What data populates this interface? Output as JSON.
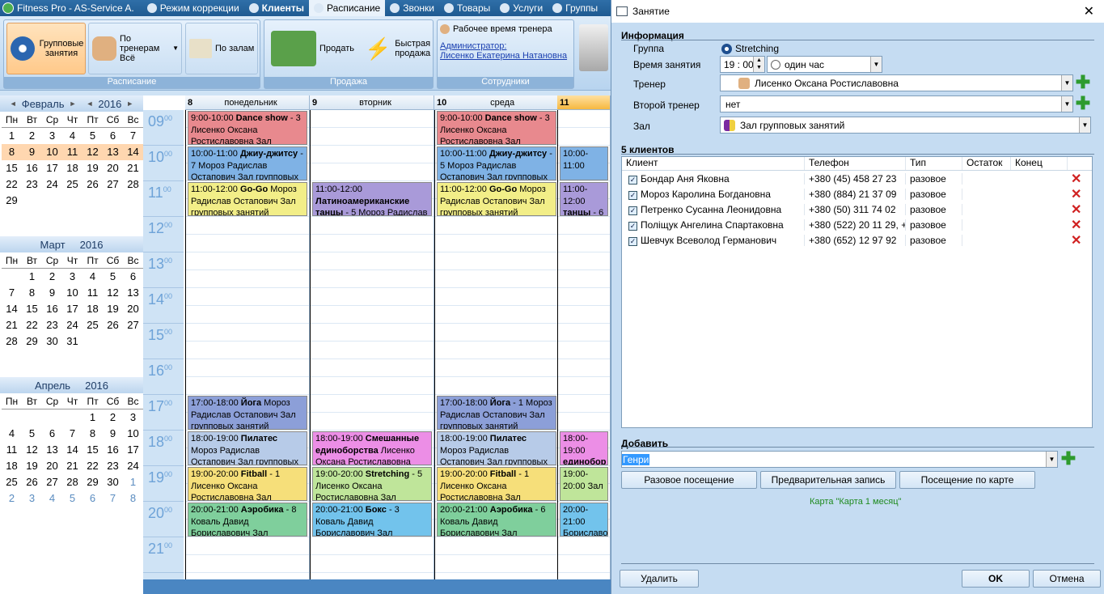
{
  "titlebar": {
    "app": "Fitness Pro - AS-Service A.",
    "tabs": [
      {
        "label": "Режим коррекции",
        "icon": "gear-icon"
      },
      {
        "label": "Клиенты",
        "icon": "people-icon",
        "bold": true
      },
      {
        "label": "Расписание",
        "icon": "calendar-icon",
        "active": true
      },
      {
        "label": "Звонки",
        "icon": "phone-icon"
      },
      {
        "label": "Товары",
        "icon": "box-icon"
      },
      {
        "label": "Услуги",
        "icon": "service-icon"
      },
      {
        "label": "Группы",
        "icon": "group-icon"
      }
    ]
  },
  "ribbon": {
    "groups": [
      {
        "title": "Расписание"
      },
      {
        "title": "Продажа"
      },
      {
        "title": "Сотрудники"
      }
    ],
    "group_classes_label": "Групповые занятия",
    "by_trainers_label": "По тренерам",
    "by_trainers_value": "Всё",
    "by_halls_label": "По залам",
    "sell_label": "Продать",
    "quick_sale_label": "Быстрая продажа",
    "trainer_time_label": "Рабочее время тренера",
    "admin_label": "Администратор:",
    "admin_name": "Лисенко Екатерина Натановна"
  },
  "calendar": {
    "weekdays": [
      "Пн",
      "Вт",
      "Ср",
      "Чт",
      "Пт",
      "Сб",
      "Вс"
    ],
    "months": [
      {
        "name": "Февраль",
        "year": "2016",
        "nav": true,
        "lead": 0,
        "days": [
          "1",
          "2",
          "3",
          "4",
          "5",
          "6",
          "7",
          "8",
          "9",
          "10",
          "11",
          "12",
          "13",
          "14",
          "15",
          "16",
          "17",
          "18",
          "19",
          "20",
          "21",
          "22",
          "23",
          "24",
          "25",
          "26",
          "27",
          "28",
          "29"
        ],
        "highlight": [
          "8",
          "9",
          "10",
          "11",
          "12",
          "13",
          "14"
        ],
        "trail": []
      },
      {
        "name": "Март",
        "year": "2016",
        "nav": false,
        "lead": 1,
        "days": [
          "1",
          "2",
          "3",
          "4",
          "5",
          "6",
          "7",
          "8",
          "9",
          "10",
          "11",
          "12",
          "13",
          "14",
          "15",
          "16",
          "17",
          "18",
          "19",
          "20",
          "21",
          "22",
          "23",
          "24",
          "25",
          "26",
          "27",
          "28",
          "29",
          "30",
          "31"
        ],
        "highlight": [],
        "trail": []
      },
      {
        "name": "Апрель",
        "year": "2016",
        "nav": false,
        "lead": 4,
        "days": [
          "1",
          "2",
          "3",
          "4",
          "5",
          "6",
          "7",
          "8",
          "9",
          "10",
          "11",
          "12",
          "13",
          "14",
          "15",
          "16",
          "17",
          "18",
          "19",
          "20",
          "21",
          "22",
          "23",
          "24",
          "25",
          "26",
          "27",
          "28",
          "29",
          "30"
        ],
        "highlight": [],
        "trail": [
          "1",
          "2",
          "3",
          "4",
          "5",
          "6",
          "7",
          "8"
        ]
      }
    ]
  },
  "schedule": {
    "hours": [
      "09",
      "10",
      "11",
      "12",
      "13",
      "14",
      "15",
      "16",
      "17",
      "18",
      "19",
      "20",
      "21"
    ],
    "minutes": "00",
    "days": [
      {
        "num": "8",
        "name": "понедельник"
      },
      {
        "num": "9",
        "name": "вторник"
      },
      {
        "num": "10",
        "name": "среда"
      },
      {
        "num": "11",
        "name": "",
        "today": true
      }
    ],
    "events": [
      {
        "day": 0,
        "start": 0,
        "len": 1,
        "color": "#e8898e",
        "time": "9:00-10:00",
        "title": "Dance show",
        "rest": " - 3 Лисенко Оксана Ростиславовна Зал"
      },
      {
        "day": 0,
        "start": 1,
        "len": 1,
        "color": "#7fb2e5",
        "time": "10:00-11:00",
        "title": "Джиу-джитсу",
        "rest": " - 7 Мороз Радислав Остапович Зал групповых"
      },
      {
        "day": 0,
        "start": 2,
        "len": 1,
        "color": "#f2ee88",
        "time": "11:00-12:00",
        "title": "Go-Go",
        "rest": " Мороз Радислав Остапович Зал групповых занятий"
      },
      {
        "day": 0,
        "start": 8,
        "len": 1,
        "color": "#8c9fd8",
        "time": "17:00-18:00",
        "title": "Йога",
        "rest": " Мороз Радислав Остапович Зал групповых занятий"
      },
      {
        "day": 0,
        "start": 9,
        "len": 1,
        "color": "#b7cbe8",
        "time": "18:00-19:00",
        "title": "Пилатес",
        "rest": " Мороз Радислав Остапович Зал групповых занятий"
      },
      {
        "day": 0,
        "start": 10,
        "len": 1,
        "color": "#f6df7a",
        "time": "19:00-20:00",
        "title": "Fitball",
        "rest": " - 1 Лисенко Оксана Ростиславовна Зал"
      },
      {
        "day": 0,
        "start": 11,
        "len": 1,
        "color": "#7fcf9c",
        "time": "20:00-21:00",
        "title": "Аэробика",
        "rest": " - 8 Коваль Давид Бориславович Зал"
      },
      {
        "day": 1,
        "start": 2,
        "len": 1,
        "color": "#a99ad9",
        "time": "11:00-12:00",
        "title": "Латиноамериканские танцы",
        "rest": " - 5 Мороз Радислав"
      },
      {
        "day": 1,
        "start": 9,
        "len": 1,
        "color": "#ec8ee6",
        "time": "18:00-19:00",
        "title": "Смешанные единоборства",
        "rest": " Лисенко Оксана Ростиславовна Зал"
      },
      {
        "day": 1,
        "start": 10,
        "len": 1,
        "color": "#bfe59a",
        "time": "19:00-20:00",
        "title": "Stretching",
        "rest": " - 5 Лисенко Оксана Ростиславовна Зал"
      },
      {
        "day": 1,
        "start": 11,
        "len": 1,
        "color": "#72c3ec",
        "time": "20:00-21:00",
        "title": "Бокс",
        "rest": " - 3 Коваль Давид Бориславович Зал групповых занятий"
      },
      {
        "day": 2,
        "start": 0,
        "len": 1,
        "color": "#e8898e",
        "time": "9:00-10:00",
        "title": "Dance show",
        "rest": " - 3 Лисенко Оксана Ростиславовна Зал"
      },
      {
        "day": 2,
        "start": 1,
        "len": 1,
        "color": "#7fb2e5",
        "time": "10:00-11:00",
        "title": "Джиу-джитсу",
        "rest": " - 5 Мороз Радислав Остапович Зал групповых"
      },
      {
        "day": 2,
        "start": 2,
        "len": 1,
        "color": "#f2ee88",
        "time": "11:00-12:00",
        "title": "Go-Go",
        "rest": " Мороз Радислав Остапович Зал групповых занятий"
      },
      {
        "day": 2,
        "start": 8,
        "len": 1,
        "color": "#8c9fd8",
        "time": "17:00-18:00",
        "title": "Йога",
        "rest": " - 1 Мороз Радислав Остапович Зал групповых занятий"
      },
      {
        "day": 2,
        "start": 9,
        "len": 1,
        "color": "#b7cbe8",
        "time": "18:00-19:00",
        "title": "Пилатес",
        "rest": " Мороз Радислав Остапович Зал групповых занятий"
      },
      {
        "day": 2,
        "start": 10,
        "len": 1,
        "color": "#f6df7a",
        "time": "19:00-20:00",
        "title": "Fitball",
        "rest": " - 1 Лисенко Оксана Ростиславовна Зал"
      },
      {
        "day": 2,
        "start": 11,
        "len": 1,
        "color": "#7fcf9c",
        "time": "20:00-21:00",
        "title": "Аэробика",
        "rest": " - 6 Коваль Давид Бориславович Зал"
      },
      {
        "day": 3,
        "start": 1,
        "len": 1,
        "color": "#7fb2e5",
        "time": "10:00-11:00",
        "title": "",
        "rest": ""
      },
      {
        "day": 3,
        "start": 2,
        "len": 1,
        "color": "#a99ad9",
        "time": "11:00-12:00",
        "title": "танцы",
        "rest": " - 6 М"
      },
      {
        "day": 3,
        "start": 9,
        "len": 1,
        "color": "#ec8ee6",
        "time": "18:00-19:00",
        "title": "единобор",
        "rest": ""
      },
      {
        "day": 3,
        "start": 10,
        "len": 1,
        "color": "#bfe59a",
        "time": "19:00-20:00",
        "title": "",
        "rest": " Зал"
      },
      {
        "day": 3,
        "start": 11,
        "len": 1,
        "color": "#72c3ec",
        "time": "20:00-21:00",
        "title": "",
        "rest": " Бориславо"
      }
    ]
  },
  "dialog": {
    "title": "Занятие",
    "info_section": "Информация",
    "group_label": "Группа",
    "group_value": "Stretching",
    "time_label": "Время занятия",
    "time_value": "19 : 00",
    "duration_value": "один час",
    "trainer_label": "Тренер",
    "trainer_value": "Лисенко Оксана Ростиславовна",
    "second_trainer_label": "Второй тренер",
    "second_trainer_value": "нет",
    "hall_label": "Зал",
    "hall_value": "Зал групповых занятий",
    "clients_section": "5 клиентов",
    "columns": [
      "Клиент",
      "Телефон",
      "Тип",
      "Остаток",
      "Конец"
    ],
    "clients": [
      {
        "name": "Бондар Аня Яковна",
        "phone": "+380 (45) 458 27 23",
        "type": "разовое"
      },
      {
        "name": "Мороз Каролина Богдановна",
        "phone": "+380 (884) 21 37 09",
        "type": "разовое"
      },
      {
        "name": "Петренко Сусанна Леонидовна",
        "phone": "+380 (50) 311 74 02",
        "type": "разовое"
      },
      {
        "name": "Поліщук Ангелина Спартаковна",
        "phone": "+380 (522) 20 11 29, +...",
        "type": "разовое"
      },
      {
        "name": "Шевчук Всеволод Германович",
        "phone": "+380 (652) 12 97 92",
        "type": "разовое"
      }
    ],
    "add_section": "Добавить",
    "add_value": "Генри",
    "btn_single": "Разовое посещение",
    "btn_prebook": "Предварительная запись",
    "btn_card": "Посещение по карте",
    "card_info": "Карта \"Карта 1 месяц\"",
    "btn_delete": "Удалить",
    "btn_ok": "OK",
    "btn_cancel": "Отмена"
  }
}
